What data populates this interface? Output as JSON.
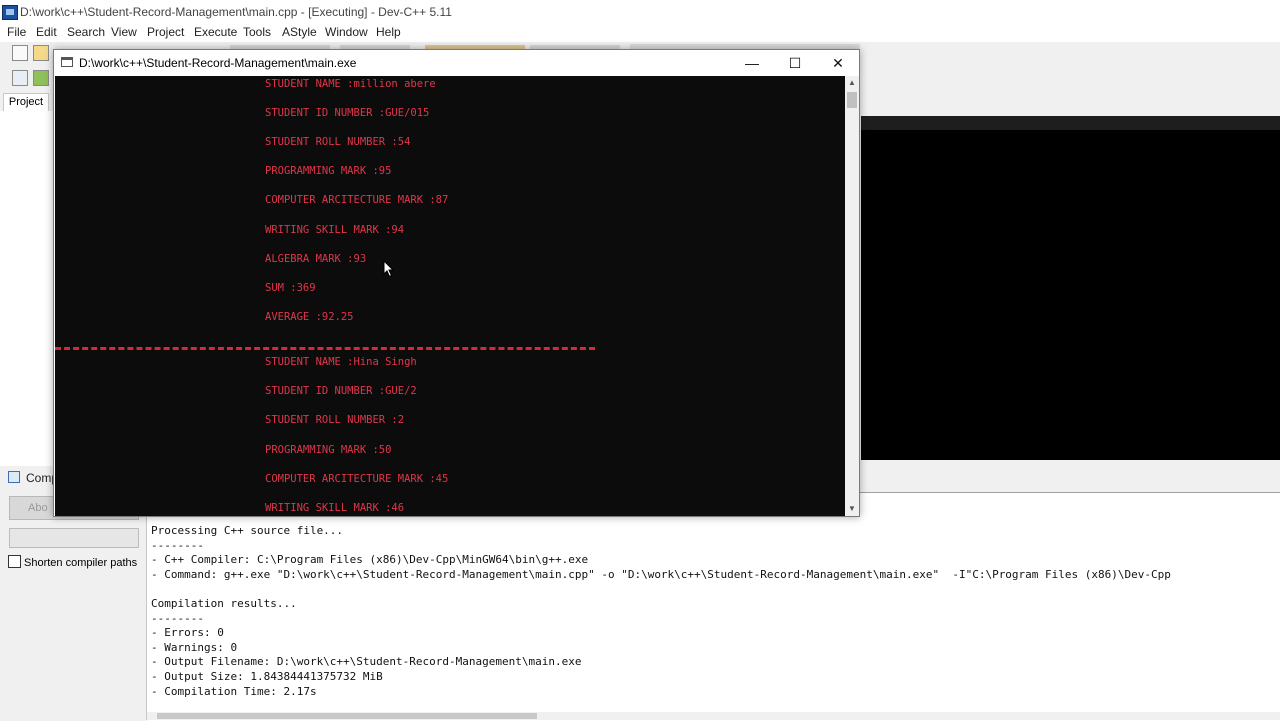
{
  "ide": {
    "title": "D:\\work\\c++\\Student-Record-Management\\main.cpp - [Executing] - Dev-C++ 5.11",
    "menu": [
      "File",
      "Edit",
      "Search",
      "View",
      "Project",
      "Execute",
      "Tools",
      "AStyle",
      "Window",
      "Help"
    ]
  },
  "left_panel": {
    "project_tab": "Project",
    "compiler_tab": "Comp",
    "abort_button": "Abo",
    "shorten_label": "Shorten compiler paths"
  },
  "console": {
    "title": "D:\\work\\c++\\Student-Record-Management\\main.exe",
    "controls": {
      "minimize": "—",
      "maximize": "☐",
      "close": "✕"
    },
    "lines_before": [
      "STUDENT NAME :million abere",
      "STUDENT ID NUMBER :GUE/015",
      "STUDENT ROLL NUMBER :54",
      "PROGRAMMING MARK :95",
      "COMPUTER ARCITECTURE MARK :87",
      "WRITING SKILL MARK :94",
      "ALGEBRA MARK :93",
      "SUM :369",
      "AVERAGE :92.25"
    ],
    "lines_after": [
      "STUDENT NAME :Hina Singh",
      "STUDENT ID NUMBER :GUE/2",
      "STUDENT ROLL NUMBER :2",
      "PROGRAMMING MARK :50",
      "COMPUTER ARCITECTURE MARK :45",
      "WRITING SKILL MARK :46"
    ]
  },
  "log": {
    "lines": [
      "Processing C++ source file...",
      "--------",
      "- C++ Compiler: C:\\Program Files (x86)\\Dev-Cpp\\MinGW64\\bin\\g++.exe",
      "- Command: g++.exe \"D:\\work\\c++\\Student-Record-Management\\main.cpp\" -o \"D:\\work\\c++\\Student-Record-Management\\main.exe\"  -I\"C:\\Program Files (x86)\\Dev-Cpp",
      "",
      "Compilation results...",
      "--------",
      "- Errors: 0",
      "- Warnings: 0",
      "- Output Filename: D:\\work\\c++\\Student-Record-Management\\main.exe",
      "- Output Size: 1.84384441375732 MiB",
      "- Compilation Time: 2.17s"
    ]
  }
}
